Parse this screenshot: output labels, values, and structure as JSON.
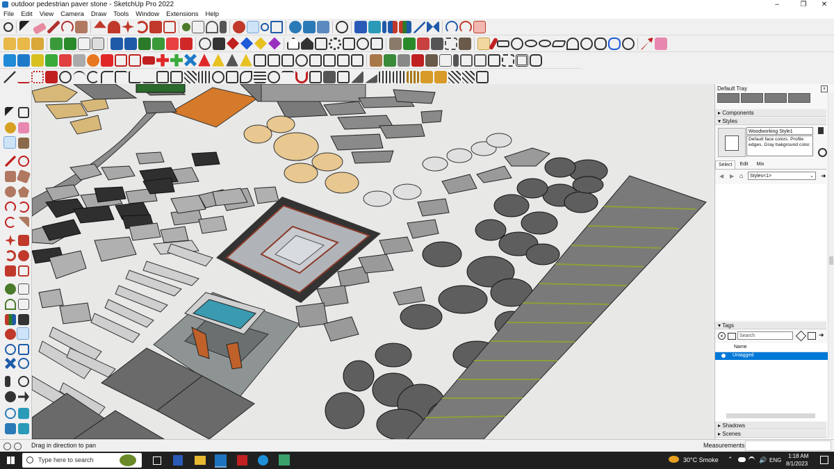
{
  "window": {
    "title": "outdoor pedestrian paver stone - SketchUp Pro 2022",
    "controls": [
      "–",
      "❐",
      "✕"
    ]
  },
  "menu": [
    "File",
    "Edit",
    "View",
    "Camera",
    "Draw",
    "Tools",
    "Window",
    "Extensions",
    "Help"
  ],
  "tray": {
    "title": "Default Tray",
    "components_label": "Components",
    "styles_label": "Styles",
    "style_name": "Woodworking Style1",
    "style_desc": "Default face colors. Profile edges. Gray bakground color.",
    "tabs": [
      "Select",
      "Edit",
      "Mix"
    ],
    "styles_dropdown": "Styles<1>",
    "tags_label": "Tags",
    "tags_search_placeholder": "Search",
    "tags_col_name": "Name",
    "tags_row": "Untagged",
    "shadows_label": "Shadows",
    "scenes_label": "Scenes"
  },
  "status": {
    "hint": "Drag in direction to pan",
    "measurements_label": "Measurements"
  },
  "taskbar": {
    "search_placeholder": "Type here to search",
    "weather": "30°C  Smoke",
    "lang": "ENG",
    "time": "1:18 AM",
    "date": "8/1/2023"
  },
  "colors": {
    "selection": "#0078d7",
    "accent_red": "#c0392b",
    "viewport_bg": "#e8e8e6",
    "taskbar_bg": "#202020"
  }
}
